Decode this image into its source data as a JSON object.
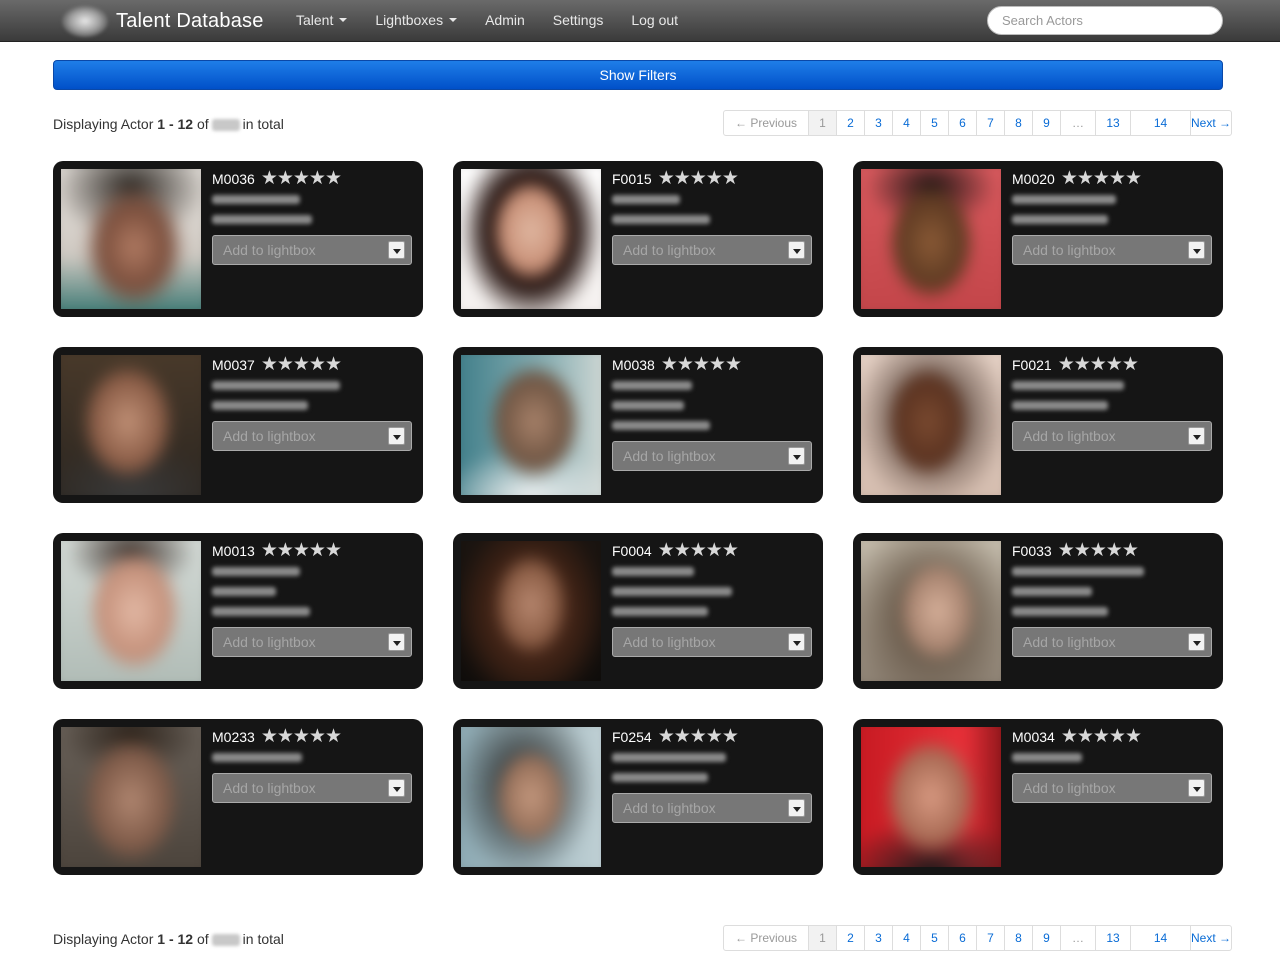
{
  "navbar": {
    "brand": "Talent Database",
    "items": [
      {
        "label": "Talent",
        "dropdown": true
      },
      {
        "label": "Lightboxes",
        "dropdown": true
      },
      {
        "label": "Admin",
        "dropdown": false
      },
      {
        "label": "Settings",
        "dropdown": false
      },
      {
        "label": "Log out",
        "dropdown": false
      }
    ],
    "search_placeholder": "Search Actors"
  },
  "filter_button": "Show Filters",
  "displaying": {
    "prefix": "Displaying Actor",
    "range": "1 - 12",
    "of": "of",
    "suffix": "in total"
  },
  "pagination": {
    "previous": "← Previous",
    "pages": [
      "1",
      "2",
      "3",
      "4",
      "5",
      "6",
      "7",
      "8",
      "9",
      "…",
      "13",
      "14"
    ],
    "next": "Next →",
    "current": "1"
  },
  "lightbox_placeholder": "Add to lightbox",
  "rating_stars": "★★★★★",
  "actors": [
    {
      "code": "M0036",
      "photo": "male-headshot"
    },
    {
      "code": "F0015",
      "photo": "female-headshot"
    },
    {
      "code": "M0020",
      "photo": "male-headshot"
    },
    {
      "code": "M0037",
      "photo": "male-headshot"
    },
    {
      "code": "M0038",
      "photo": "male-headshot"
    },
    {
      "code": "F0021",
      "photo": "female-headshot"
    },
    {
      "code": "M0013",
      "photo": "male-headshot"
    },
    {
      "code": "F0004",
      "photo": "female-headshot"
    },
    {
      "code": "F0033",
      "photo": "female-headshot"
    },
    {
      "code": "M0233",
      "photo": "male-headshot"
    },
    {
      "code": "F0254",
      "photo": "female-headshot"
    },
    {
      "code": "M0034",
      "photo": "male-headshot"
    }
  ],
  "colors": {
    "navbar": "#4a4a4a",
    "primary_button": "#0066dd",
    "card_background": "#151515",
    "link": "#0a6cd6"
  }
}
